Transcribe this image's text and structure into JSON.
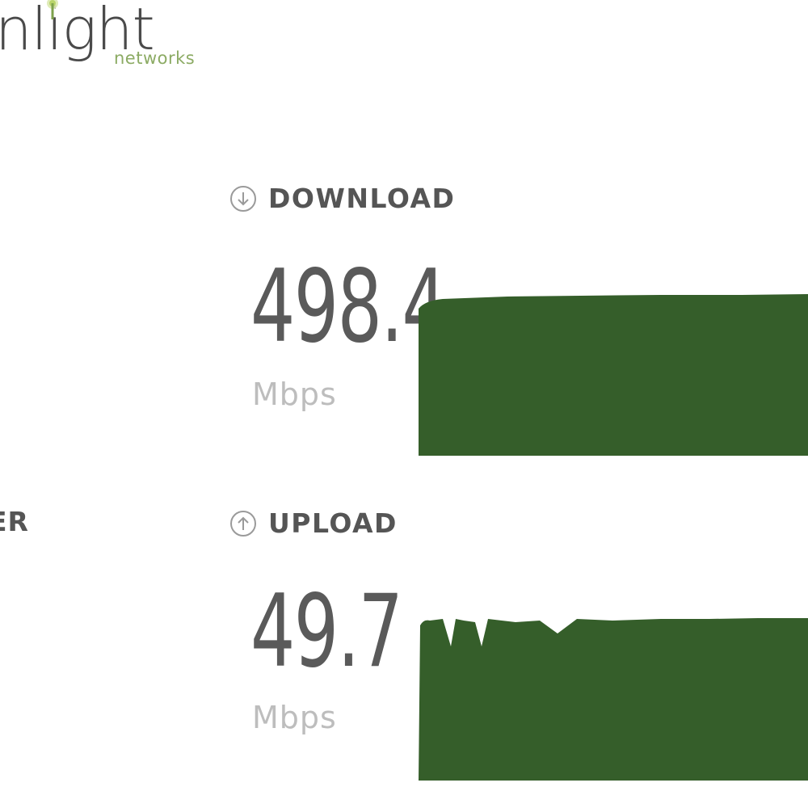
{
  "logo": {
    "word": "nlight",
    "sub": "networks"
  },
  "left_column": {
    "label_top": "",
    "label_bottom": "ER"
  },
  "download": {
    "label": "DOWNLOAD",
    "value": "498.4",
    "unit": "Mbps",
    "icon": "arrow-down-circle-icon",
    "graph_color": "#355e2a"
  },
  "upload": {
    "label": "UPLOAD",
    "value": "49.7",
    "unit": "Mbps",
    "icon": "arrow-up-circle-icon",
    "graph_color": "#355e2a"
  },
  "colors": {
    "brand_green": "#8cab64",
    "graph_green": "#355e2a",
    "text_dark": "#555555",
    "unit_gray": "#bdbdbd"
  }
}
